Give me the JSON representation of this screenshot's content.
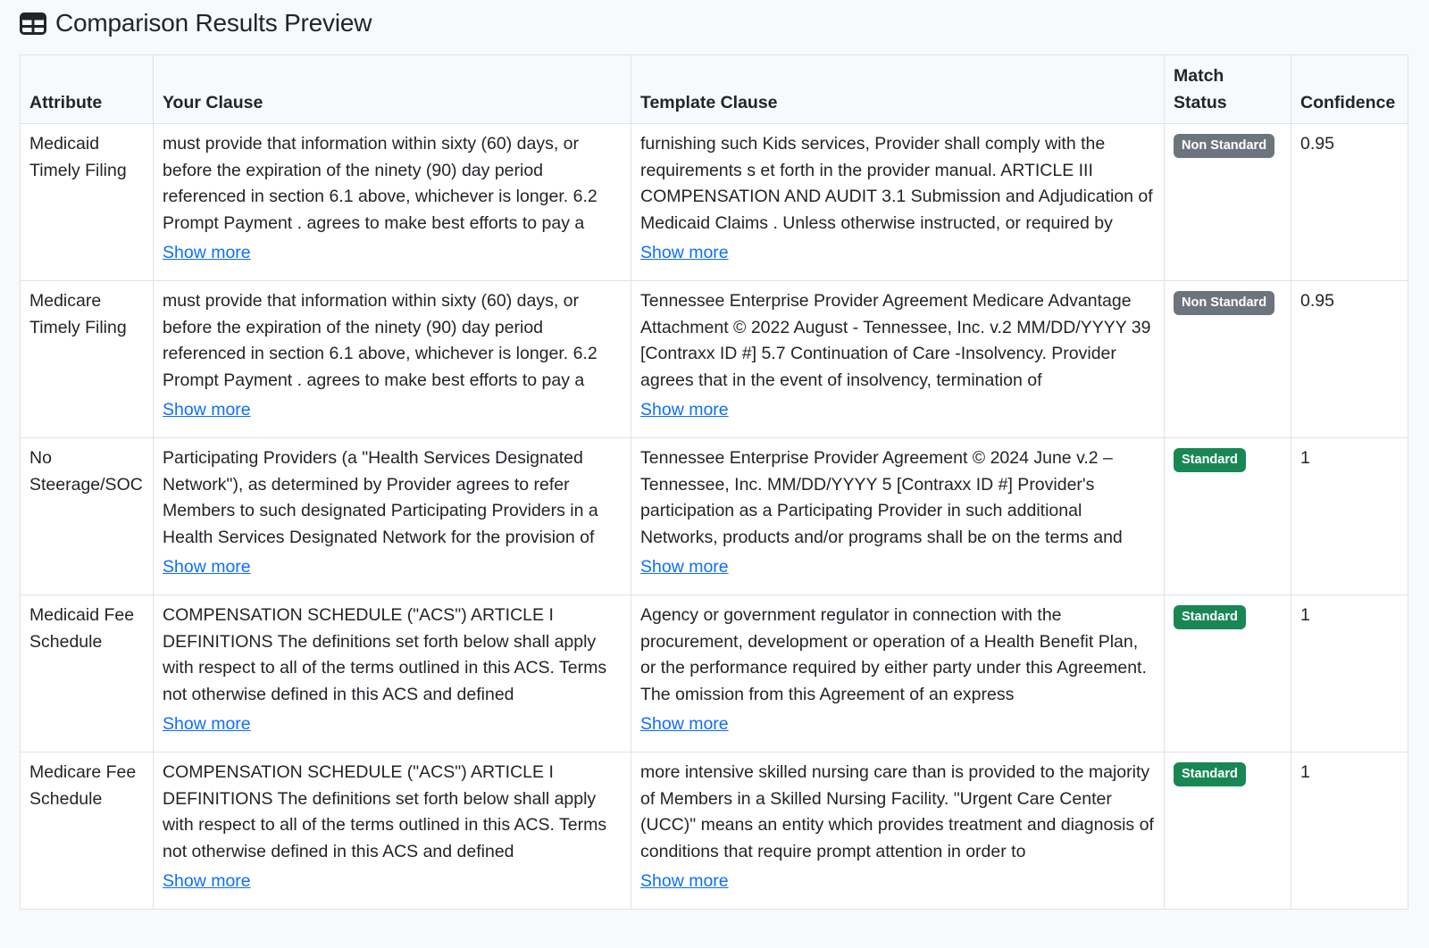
{
  "page": {
    "title": "Comparison Results Preview",
    "icon": "table-icon"
  },
  "table": {
    "headers": {
      "attribute": "Attribute",
      "your_clause": "Your Clause",
      "template_clause": "Template Clause",
      "match_status": "Match Status",
      "confidence": "Confidence"
    },
    "show_more_label": "Show more",
    "rows": [
      {
        "attribute": "Medicaid Timely Filing",
        "your_clause": "must provide that information within sixty (60) days, or before the expiration of the ninety (90) day period referenced in section 6.1 above, whichever is longer. 6.2 Prompt Payment . agrees to make best efforts to pay a",
        "template_clause": "furnishing such Kids services, Provider shall comply with the requirements s et forth in the provider manual. ARTICLE III COMPENSATION AND AUDIT 3.1 Submission and Adjudication of Medicaid Claims . Unless otherwise instructed, or required by",
        "match_status": "Non Standard",
        "status_type": "non-standard",
        "confidence": "0.95"
      },
      {
        "attribute": "Medicare Timely Filing",
        "your_clause": "must provide that information within sixty (60) days, or before the expiration of the ninety (90) day period referenced in section 6.1 above, whichever is longer. 6.2 Prompt Payment . agrees to make best efforts to pay a",
        "template_clause": "Tennessee Enterprise Provider Agreement Medicare Advantage Attachment © 2022 August - Tennessee, Inc. v.2 MM/DD/YYYY 39 [Contraxx ID #] 5.7 Continuation of Care -Insolvency. Provider agrees that in the event of insolvency, termination of",
        "match_status": "Non Standard",
        "status_type": "non-standard",
        "confidence": "0.95"
      },
      {
        "attribute": "No Steerage/SOC",
        "your_clause": "Participating Providers (a \"Health Services Designated Network\"), as determined by Provider agrees to refer Members to such designated Participating Providers in a Health Services Designated Network for the provision of",
        "template_clause": "Tennessee Enterprise Provider Agreement © 2024 June v.2 – Tennessee, Inc. MM/DD/YYYY 5 [Contraxx ID #] Provider's participation as a Participating Provider in such additional Networks, products and/or programs shall be on the terms and",
        "match_status": "Standard",
        "status_type": "standard",
        "confidence": "1"
      },
      {
        "attribute": "Medicaid Fee Schedule",
        "your_clause": "COMPENSATION SCHEDULE (\"ACS\") ARTICLE I DEFINITIONS The definitions set forth below shall apply with respect to all of the terms outlined in this ACS. Terms not otherwise defined in this ACS and defined",
        "template_clause": "Agency or government regulator in connection with the procurement, development or operation of a Health Benefit Plan, or the performance required by either party under this Agreement. The omission from this Agreement of an express",
        "match_status": "Standard",
        "status_type": "standard",
        "confidence": "1"
      },
      {
        "attribute": "Medicare Fee Schedule",
        "your_clause": "COMPENSATION SCHEDULE (\"ACS\") ARTICLE I DEFINITIONS The definitions set forth below shall apply with respect to all of the terms outlined in this ACS. Terms not otherwise defined in this ACS and defined",
        "template_clause": "more intensive skilled nursing care than is provided to the majority of Members in a Skilled Nursing Facility. \"Urgent Care Center (UCC)\" means an entity which provides treatment and diagnosis of conditions that require prompt attention in order to",
        "match_status": "Standard",
        "status_type": "standard",
        "confidence": "1"
      }
    ]
  }
}
